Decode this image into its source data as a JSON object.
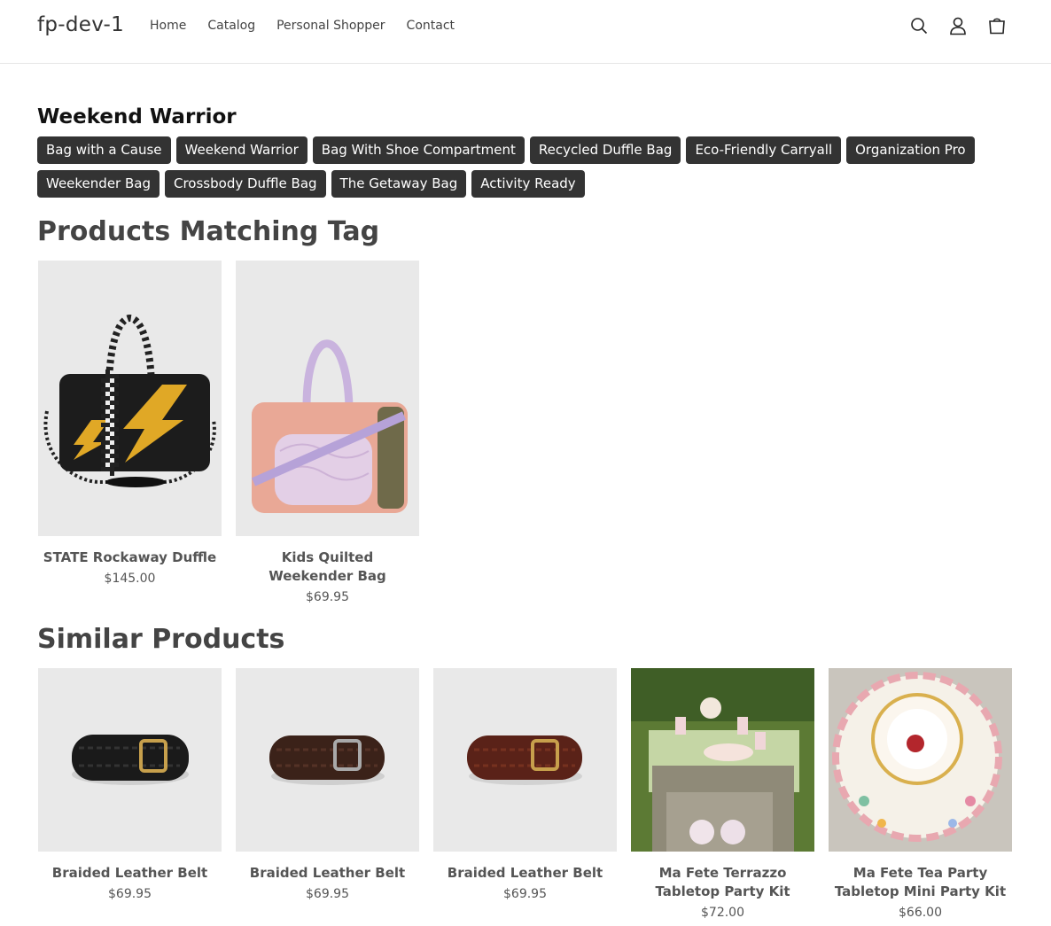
{
  "header": {
    "logo": "fp-dev-1",
    "nav": [
      "Home",
      "Catalog",
      "Personal Shopper",
      "Contact"
    ],
    "icons": [
      "search-icon",
      "account-icon",
      "cart-icon"
    ]
  },
  "tag_page": {
    "heading": "Weekend Warrior",
    "tags": [
      "Bag with a Cause",
      "Weekend Warrior",
      "Bag With Shoe Compartment",
      "Recycled Duffle Bag",
      "Eco-Friendly Carryall",
      "Organization Pro",
      "Weekender Bag",
      "Crossbody Duffle Bag",
      "The Getaway Bag",
      "Activity Ready"
    ]
  },
  "matching": {
    "title": "Products Matching Tag",
    "products": [
      {
        "name": "STATE Rockaway Duffle",
        "price": "$145.00"
      },
      {
        "name": "Kids Quilted Weekender Bag",
        "price": "$69.95"
      }
    ]
  },
  "similar": {
    "title": "Similar Products",
    "products": [
      {
        "name": "Braided Leather Belt",
        "price": "$69.95"
      },
      {
        "name": "Braided Leather Belt",
        "price": "$69.95"
      },
      {
        "name": "Braided Leather Belt",
        "price": "$69.95"
      },
      {
        "name": "Ma Fete Terrazzo Tabletop Party Kit",
        "price": "$72.00"
      },
      {
        "name": "Ma Fete Tea Party Tabletop Mini Party Kit",
        "price": "$66.00"
      }
    ]
  }
}
